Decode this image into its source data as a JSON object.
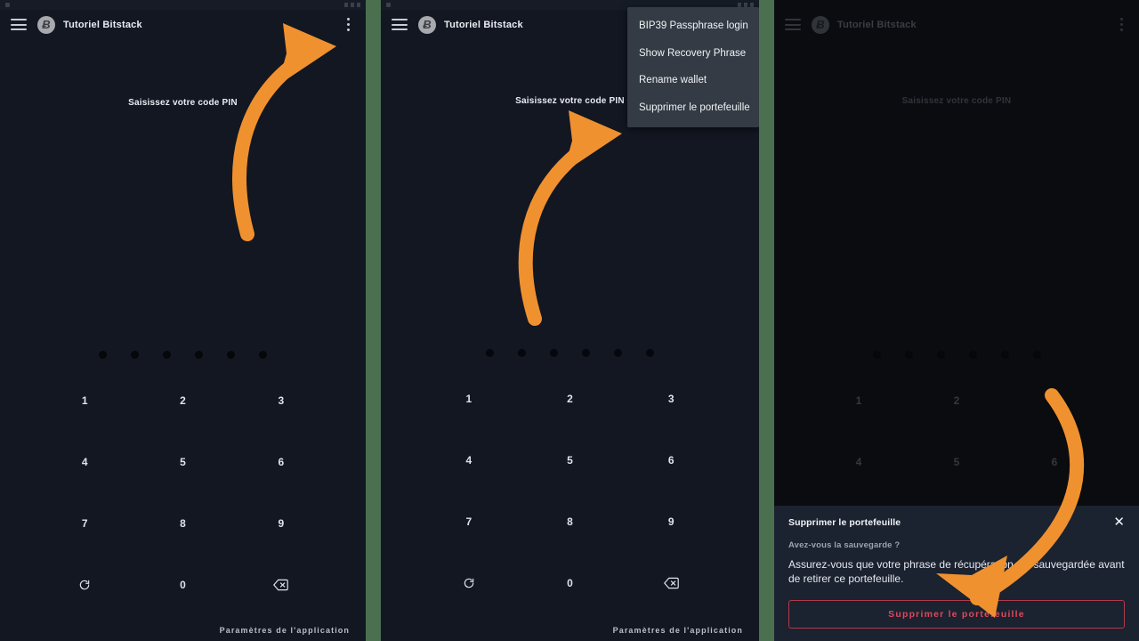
{
  "meta": {
    "accent_orange": "#F0912F",
    "panel_background": "#121722",
    "panel_background_dim": "#0A0C10",
    "divider_color": "#4A7050",
    "menu_background": "#343B44",
    "dialog_background": "#1B2230",
    "danger_color": "#E0485C",
    "danger_border": "#B03A4A"
  },
  "appbar": {
    "menu_icon": "hamburger-icon",
    "logo_glyph": "Ƀ",
    "logo_name": "bitcoin-logo-icon",
    "title": "Tutoriel Bitstack",
    "overflow_icon": "kebab-menu-icon"
  },
  "pin_screen": {
    "prompt": "Saisissez votre code PIN",
    "dot_count": 6,
    "keys": [
      {
        "label": "1",
        "name": "key-1"
      },
      {
        "label": "2",
        "name": "key-2"
      },
      {
        "label": "3",
        "name": "key-3"
      },
      {
        "label": "4",
        "name": "key-4"
      },
      {
        "label": "5",
        "name": "key-5"
      },
      {
        "label": "6",
        "name": "key-6"
      },
      {
        "label": "7",
        "name": "key-7"
      },
      {
        "label": "8",
        "name": "key-8"
      },
      {
        "label": "9",
        "name": "key-9"
      },
      {
        "label": "",
        "name": "key-shuffle",
        "icon": "refresh-icon"
      },
      {
        "label": "0",
        "name": "key-0"
      },
      {
        "label": "",
        "name": "key-backspace",
        "icon": "backspace-icon"
      }
    ],
    "app_settings_label": "Paramètres de l'application"
  },
  "overflow_menu": {
    "items": [
      "BIP39 Passphrase login",
      "Show Recovery Phrase",
      "Rename wallet",
      "Supprimer le portefeuille"
    ]
  },
  "delete_dialog": {
    "title": "Supprimer le portefeuille",
    "close_icon": "close-icon",
    "close_glyph": "✕",
    "subtitle": "Avez-vous la sauvegarde ?",
    "body": "Assurez-vous que votre phrase de récupération est sauvegardée avant de retirer ce portefeuille.",
    "confirm_label": "Supprimer le portefeuille"
  },
  "annotations": {
    "arrow_1": "curved-arrow-to-overflow-menu",
    "arrow_2": "curved-arrow-to-menu-item",
    "arrow_3": "curved-arrow-to-delete-button"
  }
}
